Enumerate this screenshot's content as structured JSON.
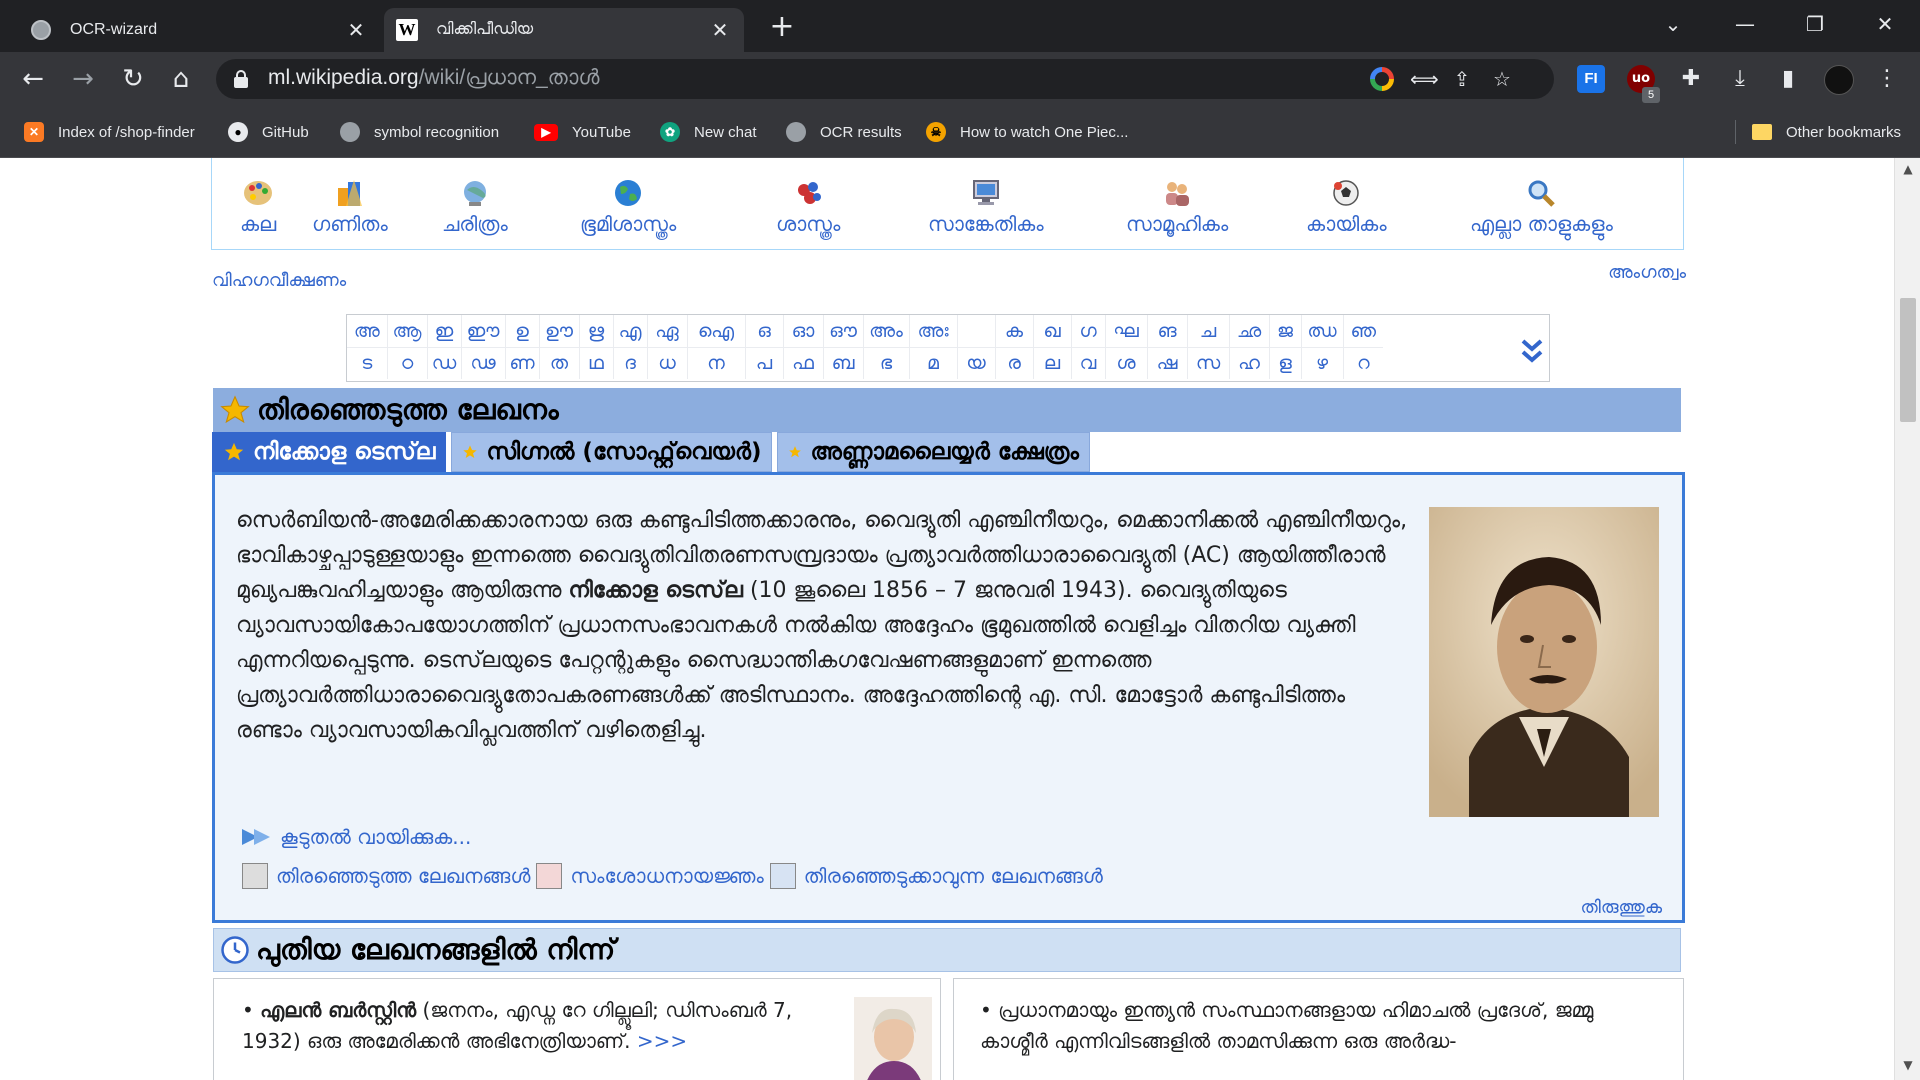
{
  "browser": {
    "tabs": [
      {
        "title": "OCR-wizard",
        "active": false
      },
      {
        "title": "വിക്കിപീഡിയ",
        "active": true
      }
    ],
    "url_host": "ml.wikipedia.org",
    "url_path": "/wiki/പ്രധാന_താൾ",
    "extension_badge": "5",
    "bookmarks": [
      {
        "label": "Index of /shop-finder",
        "icon": "xampp-icon"
      },
      {
        "label": "GitHub",
        "icon": "github-icon"
      },
      {
        "label": "symbol recognition",
        "icon": "globe-icon"
      },
      {
        "label": "YouTube",
        "icon": "youtube-icon"
      },
      {
        "label": "New chat",
        "icon": "openai-icon"
      },
      {
        "label": "OCR results",
        "icon": "globe-icon"
      },
      {
        "label": "How to watch One Piec...",
        "icon": "onepiece-icon"
      }
    ],
    "other_bookmarks": "Other bookmarks"
  },
  "portals": [
    {
      "label": "കല",
      "icon": "palette-icon"
    },
    {
      "label": "ഗണിതം",
      "icon": "shapes-icon"
    },
    {
      "label": "ചരിത്രം",
      "icon": "history-globe-icon"
    },
    {
      "label": "ഭൂമിശാസ്ത്രം",
      "icon": "earth-icon"
    },
    {
      "label": "ശാസ്ത്രം",
      "icon": "atom-icon"
    },
    {
      "label": "സാങ്കേതികം",
      "icon": "monitor-icon"
    },
    {
      "label": "സാമൂഹികം",
      "icon": "people-icon"
    },
    {
      "label": "കായികം",
      "icon": "ball-icon"
    },
    {
      "label": "എല്ലാ താളുകളും",
      "icon": "magnifier-icon"
    }
  ],
  "links": {
    "overview": "വിഹഗവീക്ഷണം",
    "member": "അംഗത്വം"
  },
  "alphabet": {
    "row1": [
      "അ",
      "ആ",
      "ഇ",
      "ഈ",
      "ഉ",
      "ഊ",
      "ഋ",
      "എ",
      "ഏ",
      "ഐ",
      "ഒ",
      "ഓ",
      "ഔ",
      "അം",
      "അഃ",
      "",
      "ക",
      "ഖ",
      "ഗ",
      "ഘ",
      "ങ",
      "ച",
      "ഛ",
      "ജ",
      "ഝ",
      "ഞ"
    ],
    "row2": [
      "ട",
      "ഠ",
      "ഡ",
      "ഢ",
      "ണ",
      "ത",
      "ഥ",
      "ദ",
      "ധ",
      "ന",
      "പ",
      "ഫ",
      "ബ",
      "ഭ",
      "മ",
      "യ",
      "ര",
      "ല",
      "വ",
      "ശ",
      "ഷ",
      "സ",
      "ഹ",
      "ള",
      "ഴ",
      "റ"
    ]
  },
  "featured": {
    "heading": "തിരഞ്ഞെടുത്ത ലേഖനം",
    "tabs": [
      "നിക്കോള ടെസ്‌ല",
      "സിഗ്നൽ (സോഫ്റ്റ്‌വെയർ)",
      "അണ്ണാമലൈയ്യർ ക്ഷേത്രം"
    ],
    "text_before": "സെർബിയൻ-അമേരിക്കക്കാരനായ ഒരു കണ്ടുപിടിത്തക്കാരനും, വൈദ്യുതി എഞ്ചിനീയറും, മെക്കാനിക്കൽ എഞ്ചിനീയറും, ഭാവികാഴ്ചപ്പാടുള്ളയാളും ഇന്നത്തെ വൈദ്യുതിവിതരണസമ്പ്രദായം പ്രത്യാവർത്തിധാരാവൈദ്യുതി (AC) ആയിത്തീരാൻ മുഖ്യപങ്കുവഹിച്ചയാളും ആയിരുന്നു ",
    "text_bold": "നിക്കോള ടെസ്‌ല",
    "text_after": " (10 ജൂലൈ 1856 – 7 ജനുവരി 1943). വൈദ്യുതിയുടെ വ്യാവസായികോപയോഗത്തിന് പ്രധാനസംഭാവനകൾ നൽകിയ അദ്ദേഹം ഭൂമുഖത്തിൽ വെളിച്ചം വിതറിയ വ്യക്തി എന്നറിയപ്പെടുന്നു. ടെസ്‌ലയുടെ പേറ്റന്റുകളും സൈദ്ധാന്തികഗവേഷണങ്ങളുമാണ് ഇന്നത്തെ പ്രത്യാവർത്തിധാരാവൈദ്യുതോപകരണങ്ങൾക്ക് അടിസ്ഥാനം. അദ്ദേഹത്തിന്റെ എ. സി. മോട്ടോർ കണ്ടുപിടിത്തം രണ്ടാം വ്യാവസായികവിപ്ലവത്തിന് വഴിതെളിച്ചു.",
    "read_more": "കൂടുതൽ വായിക്കുക...",
    "bottom_links": [
      "തിരഞ്ഞെടുത്ത ലേഖനങ്ങൾ",
      "സംശോധനായജ്ഞം",
      "തിരഞ്ഞെടുക്കാവുന്ന ലേഖനങ്ങൾ"
    ],
    "edit": "തിരുത്തുക"
  },
  "new_articles": {
    "heading": "പുതിയ ലേഖനങ്ങളിൽ നിന്ന്",
    "left_bold": "എലൻ ബർസ്റ്റിൻ",
    "left_text": " (ജനനം, എഡ്ന റേ ഗില്ലൂലി; ഡിസംബർ 7, 1932) ഒരു അമേരിക്കൻ അഭിനേത്രിയാണ്. ",
    "more": ">>>",
    "right_text": "പ്രധാനമായും ഇന്ത്യൻ സംസ്ഥാനങ്ങളായ ഹിമാചൽ പ്രദേശ്, ജമ്മു കാശ്മീർ എന്നിവിടങ്ങളിൽ താമസിക്കുന്ന ഒരു അർദ്ധ-"
  },
  "colors": {
    "link": "#3366cc",
    "section_header": "#8cadde",
    "tab_active": "#3366cc",
    "featured_border": "#3b7bd8"
  }
}
